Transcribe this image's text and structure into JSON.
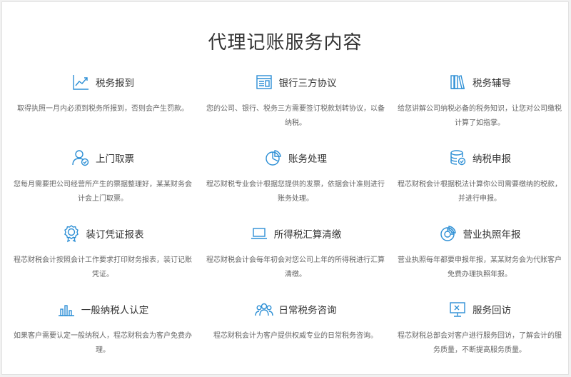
{
  "page_title": "代理记账服务内容",
  "accent_color": "#2d8fd5",
  "services": [
    {
      "label": "税务报到",
      "icon": "trend-line-icon",
      "desc": "取得执照一月内必须到税务所报到，否则会产生罚款。"
    },
    {
      "label": "银行三方协议",
      "icon": "browser-window-icon",
      "desc": "您的公司、银行、税务三方需要签订税款划转协议，以备纳税。"
    },
    {
      "label": "税务辅导",
      "icon": "books-icon",
      "desc": "给您讲解公司纳税必备的税务知识，让您对公司缴税计算了如指掌。"
    },
    {
      "label": "上门取票",
      "icon": "user-check-icon",
      "desc": "您每月需要把公司经营所产生的票据整理好，某某财务会计会上门取票。"
    },
    {
      "label": "账务处理",
      "icon": "pie-chart-icon",
      "desc": "程芯财税专业会计根据您提供的发票，依据会计准则进行账务处理。"
    },
    {
      "label": "纳税申报",
      "icon": "database-icon",
      "desc": "程芯财税会计根据税法计算你公司需要缴纳的税款，并进行申报。"
    },
    {
      "label": "装订凭证报表",
      "icon": "award-badge-icon",
      "desc": "程芯财税会计按照会计工作要求打印财务报表，装订记账凭证。"
    },
    {
      "label": "所得税汇算清缴",
      "icon": "laptop-icon",
      "desc": "程芯财税会计会每年初会对您公司上年的所得税进行汇算清缴。"
    },
    {
      "label": "营业执照年报",
      "icon": "donut-chart-icon",
      "desc": "营业执照每年都要申报年报，某某财务会为代账客户免费办理执照年报。"
    },
    {
      "label": "一般纳税人认定",
      "icon": "bar-chart-icon",
      "desc": "如果客户需要认定一般纳税人，程芯财税会为客户免费办理。"
    },
    {
      "label": "日常税务咨询",
      "icon": "user-group-icon",
      "desc": "程芯财税会计为客户提供权威专业的日常税务咨询。"
    },
    {
      "label": "服务回访",
      "icon": "monitor-icon",
      "desc": "程芯财税总部会对客户进行服务回访，了解会计的服务质量，不断提高服务质量。"
    }
  ]
}
